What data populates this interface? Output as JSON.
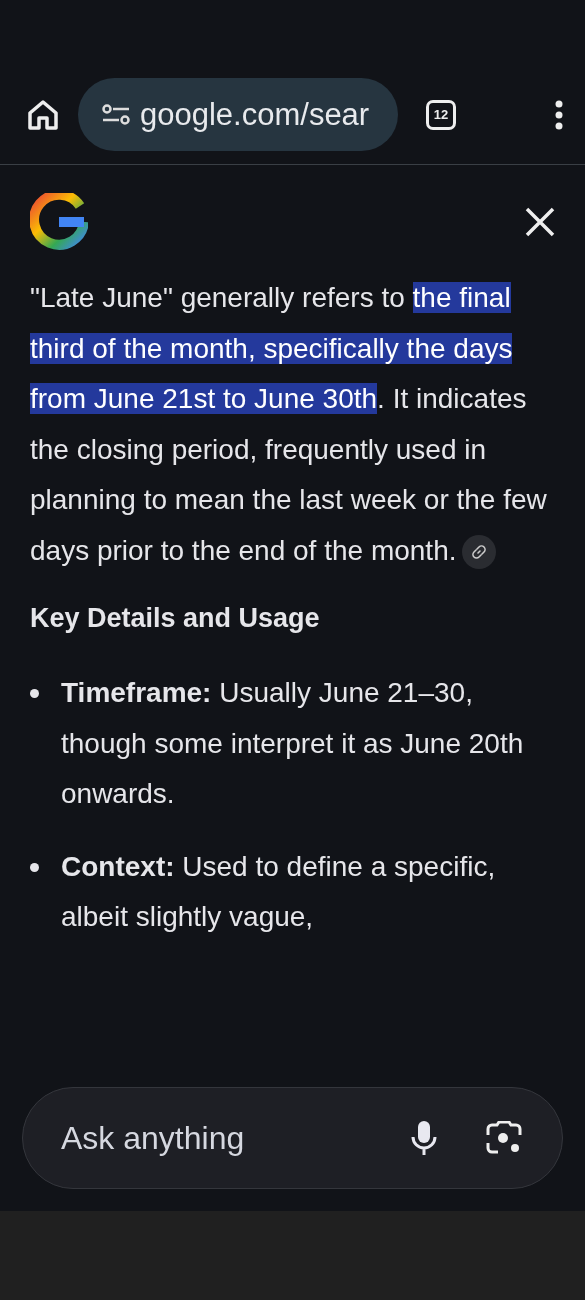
{
  "toolbar": {
    "url": "google.com/sear",
    "tab_count": "12"
  },
  "answer": {
    "parts": [
      {
        "text": "\"Late June\" generally refers to ",
        "highlighted": false
      },
      {
        "text": "the final third of the month, specifically the days from June 21st to June 30th",
        "highlighted": true
      },
      {
        "text": ". It indicates the closing period, frequently used in planning to mean the last week or the few days prior to the end of the month.",
        "highlighted": false
      }
    ]
  },
  "heading": "Key Details and Usage",
  "bullets": [
    {
      "text": "**Timeframe:** Usually June 21–30, though some interpret it as June 20th onwards."
    },
    {
      "text": "**Context:** Used to define a specific, albeit slightly vague,"
    }
  ],
  "ask_bar": {
    "placeholder": "Ask anything"
  }
}
